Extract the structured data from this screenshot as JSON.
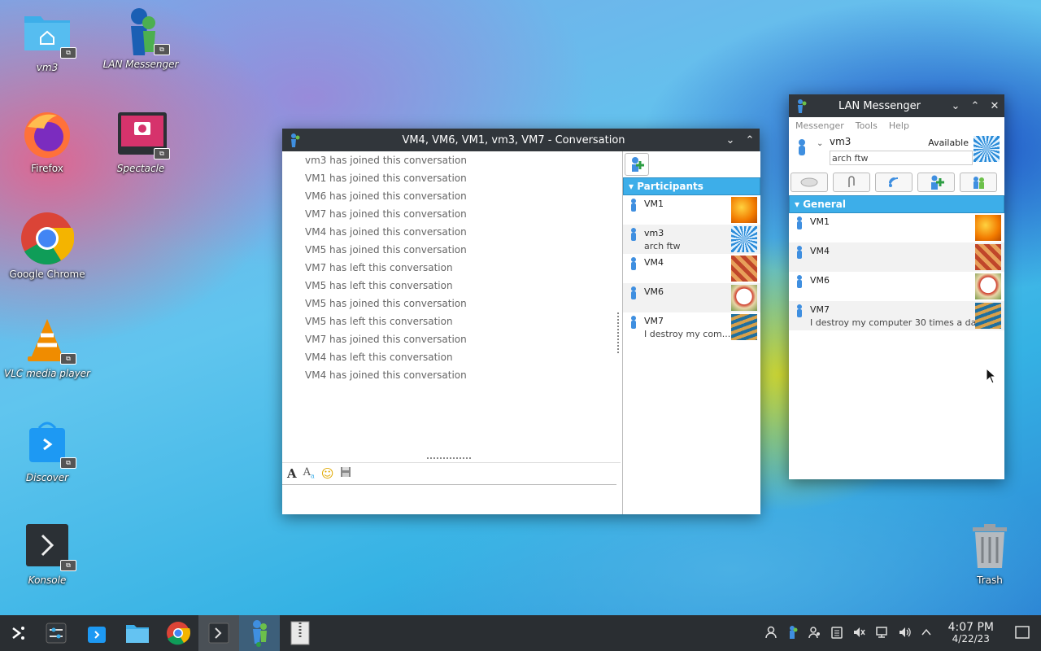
{
  "desktop": {
    "icons": [
      {
        "label": "vm3",
        "italic": true
      },
      {
        "label": "LAN Messenger",
        "italic": true
      },
      {
        "label": "Firefox",
        "italic": false
      },
      {
        "label": "Spectacle",
        "italic": true
      },
      {
        "label": "Google Chrome",
        "italic": false
      },
      {
        "label": "VLC media player",
        "italic": true
      },
      {
        "label": "Discover",
        "italic": true
      },
      {
        "label": "Konsole",
        "italic": true
      },
      {
        "label": "Trash",
        "italic": false
      }
    ]
  },
  "conversation": {
    "title": "VM4, VM6, VM1, vm3, VM7 - Conversation",
    "messages": [
      "vm3 has joined this conversation",
      "VM1 has joined this conversation",
      "VM6 has joined this conversation",
      "VM7 has joined this conversation",
      "VM4 has joined this conversation",
      "VM5 has joined this conversation",
      "VM7 has left this conversation",
      "VM5 has left this conversation",
      "VM5 has joined this conversation",
      "VM5 has left this conversation",
      "VM7 has joined this conversation",
      "VM4 has left this conversation",
      "VM4 has joined this conversation"
    ],
    "participants_header": "Participants",
    "participants": [
      {
        "name": "VM1",
        "status": ""
      },
      {
        "name": "vm3",
        "status": "arch ftw"
      },
      {
        "name": "VM4",
        "status": ""
      },
      {
        "name": "VM6",
        "status": ""
      },
      {
        "name": "VM7",
        "status": "I destroy my com..."
      }
    ]
  },
  "messenger": {
    "title": "LAN Messenger",
    "menu": [
      "Messenger",
      "Tools",
      "Help"
    ],
    "user_name": "vm3",
    "availability": "Available",
    "status_message": "arch ftw",
    "group_header": "General",
    "contacts": [
      {
        "name": "VM1",
        "status": ""
      },
      {
        "name": "VM4",
        "status": ""
      },
      {
        "name": "VM6",
        "status": ""
      },
      {
        "name": "VM7",
        "status": "I destroy my computer 30 times a da..."
      }
    ]
  },
  "clock": {
    "time": "4:07 PM",
    "date": "4/22/23"
  }
}
